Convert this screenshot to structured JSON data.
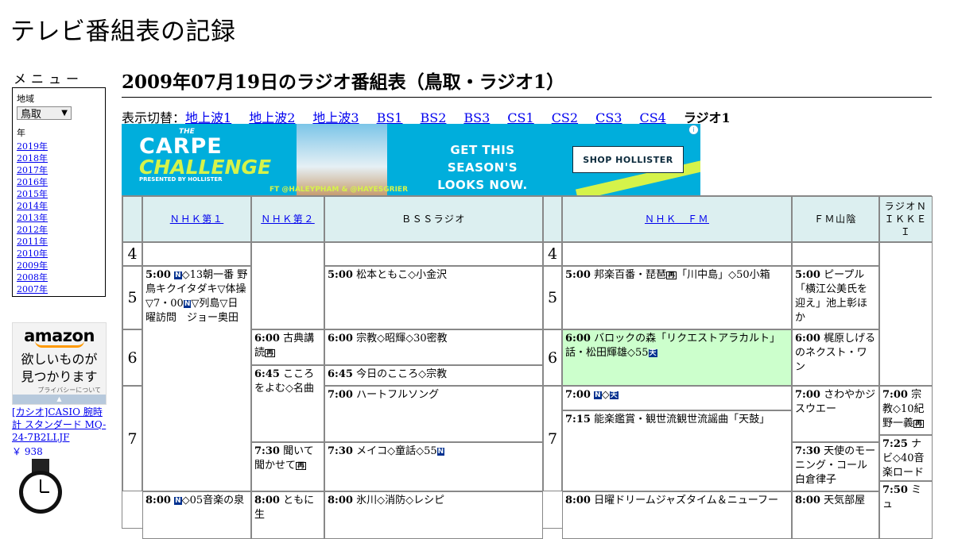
{
  "site_title": "テレビ番組表の記録",
  "sidebar": {
    "menu_heading": "メニュー",
    "region_label": "地域",
    "region_value": "鳥取",
    "year_label": "年",
    "years": [
      "2019年",
      "2018年",
      "2017年",
      "2016年",
      "2015年",
      "2014年",
      "2013年",
      "2012年",
      "2011年",
      "2010年",
      "2009年",
      "2008年",
      "2007年"
    ]
  },
  "amazon_ad": {
    "logo": "amazon",
    "message_line1": "欲しいものが",
    "message_line2": "見つかります",
    "privacy": "プライバシーについて",
    "product_title": "[カシオ]CASIO 腕時計 スタンダード MQ-24-7B2LLJF",
    "product_price": "￥ 938"
  },
  "page_title": "2009年07月19日のラジオ番組表（鳥取・ラジオ1）",
  "switcher": {
    "label": "表示切替：",
    "links": [
      "地上波1",
      "地上波2",
      "地上波3",
      "BS1",
      "BS2",
      "BS3",
      "CS1",
      "CS2",
      "CS3",
      "CS4"
    ],
    "current": "ラジオ1"
  },
  "banner_ad": {
    "the": "THE",
    "carpe": "CARPE",
    "challenge": "CHALLENGE",
    "presented_by": "PRESENTED BY HOLLISTER",
    "tagline1": "GET THIS SEASON'S",
    "tagline2": "LOOKS NOW.",
    "handles": "FT @HALEYPHAM & @HAYESGRIER",
    "cta": "SHOP HOLLISTER",
    "info": "i"
  },
  "schedule": {
    "channels": [
      "ＮＨＫ第１",
      "ＮＨＫ第２",
      "ＢＳＳラジオ",
      "ＮＨＫ　ＦＭ",
      "ＦＭ山陰",
      "ラジオＮＩＫＫＥＩ"
    ],
    "hours": [
      "4",
      "5",
      "6",
      "7",
      "4",
      "5",
      "6",
      "7"
    ],
    "programs": {
      "nhk1_500_time": "5:00",
      "nhk1_500_title": "◇13朝一番 野鳥キクイタダキ▽体操▽7・00",
      "nhk1_500_title2": "▽列島▽日曜訪問　ジョー奥田",
      "nhk1_800_time": "8:00",
      "nhk1_800_title": "◇05音楽の泉",
      "nhk2_600_time": "6:00",
      "nhk2_600_title": "古典講読",
      "nhk2_645_time": "6:45",
      "nhk2_645_title": "こころをよむ◇名曲",
      "nhk2_730_time": "7:30",
      "nhk2_730_title": "聞いて聞かせて",
      "nhk2_800_time": "8:00",
      "nhk2_800_title": "ともに生",
      "bss_500_time": "5:00",
      "bss_500_title": "松本ともこ◇小金沢",
      "bss_600_time": "6:00",
      "bss_600_title": "宗教◇昭輝◇30密教",
      "bss_645_time": "6:45",
      "bss_645_title": "今日のこころ◇宗教",
      "bss_700_time": "7:00",
      "bss_700_title": "ハートフルソング",
      "bss_730_time": "7:30",
      "bss_730_title": "メイコ◇童話◇55",
      "bss_800_time": "8:00",
      "bss_800_title": "氷川◇消防◇レシピ",
      "fm_500_time": "5:00",
      "fm_500_title": "邦楽百番・琵琶",
      "fm_500_title2": "「川中島」◇50小箱",
      "fm_600_time": "6:00",
      "fm_600_title": "バロックの森「リクエストアラカルト」話・松田輝雄◇55",
      "fm_700_time": "7:00",
      "fm_700_title": "◇",
      "fm_715_time": "7:15",
      "fm_715_title": "能楽鑑賞・観世流観世流謡曲「天鼓」",
      "fm_800_time": "8:00",
      "fm_800_title": "日曜ドリームジャズタイム＆ニューフー",
      "fms_500_time": "5:00",
      "fms_500_title": "ピープル「横江公美氏を迎え」池上彰ほか",
      "fms_600_time": "6:00",
      "fms_600_title": "梶原しげるのネクスト・ワン",
      "fms_700_time": "7:00",
      "fms_700_title": "さわやかジスウエー",
      "fms_730_time": "7:30",
      "fms_730_title": "天使のモーニング・コール 白倉律子",
      "fms_800_time": "8:00",
      "fms_800_title": "天気部屋",
      "nk_700_time": "7:00",
      "nk_700_title": "宗教◇10紀野一義",
      "nk_725_time": "7:25",
      "nk_725_title": "ナビ◇40音楽ロード",
      "nk_750_time": "7:50",
      "nk_750_title": "ミュ"
    },
    "badges": {
      "news": "N",
      "repeat": "再",
      "weather": "天"
    }
  },
  "colors": {
    "header_bg": "#dceff0",
    "highlight_bg": "#ccffcc",
    "link": "#0000ee",
    "ad_bg": "#00aedc"
  }
}
